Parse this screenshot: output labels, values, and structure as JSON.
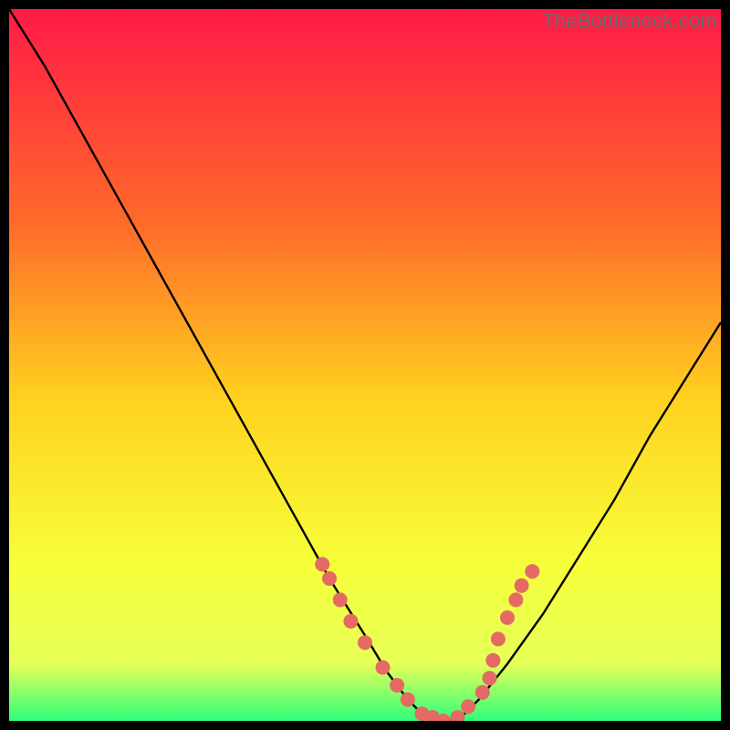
{
  "watermark": "TheBottleneck.com",
  "colors": {
    "frame": "#000000",
    "gradient_top": "#ff1a47",
    "gradient_mid_upper": "#ff6a2a",
    "gradient_mid": "#ffd21f",
    "gradient_lower": "#f6ff3a",
    "gradient_base": "#e6ff58",
    "gradient_bottom": "#2fff7a",
    "curve": "#000000",
    "marker": "#e46a63"
  },
  "chart_data": {
    "type": "line",
    "title": "",
    "xlabel": "",
    "ylabel": "",
    "xlim": [
      0,
      100
    ],
    "ylim": [
      0,
      100
    ],
    "series": [
      {
        "name": "bottleneck-curve",
        "x": [
          0,
          5,
          10,
          15,
          20,
          25,
          30,
          35,
          40,
          45,
          50,
          53,
          56,
          58,
          60,
          62,
          64,
          66,
          70,
          75,
          80,
          85,
          90,
          95,
          100
        ],
        "y": [
          100,
          92,
          83,
          74,
          65,
          56,
          47,
          38,
          29,
          20,
          12,
          7,
          3,
          1,
          0,
          0,
          1,
          3,
          8,
          15,
          23,
          31,
          40,
          48,
          56
        ]
      }
    ],
    "markers": {
      "name": "highlight-points",
      "x": [
        44,
        45,
        46.5,
        48,
        50,
        52.5,
        54.5,
        56,
        58,
        59.5,
        61,
        63,
        64.5,
        66.5,
        67.5,
        68,
        68.7,
        70,
        71.2,
        72,
        73.5
      ],
      "y": [
        22,
        20,
        17,
        14,
        11,
        7.5,
        5,
        3,
        1,
        0.5,
        0,
        0.5,
        2,
        4,
        6,
        8.5,
        11.5,
        14.5,
        17,
        19,
        21
      ],
      "color": "#e46a63",
      "size": 8
    }
  }
}
